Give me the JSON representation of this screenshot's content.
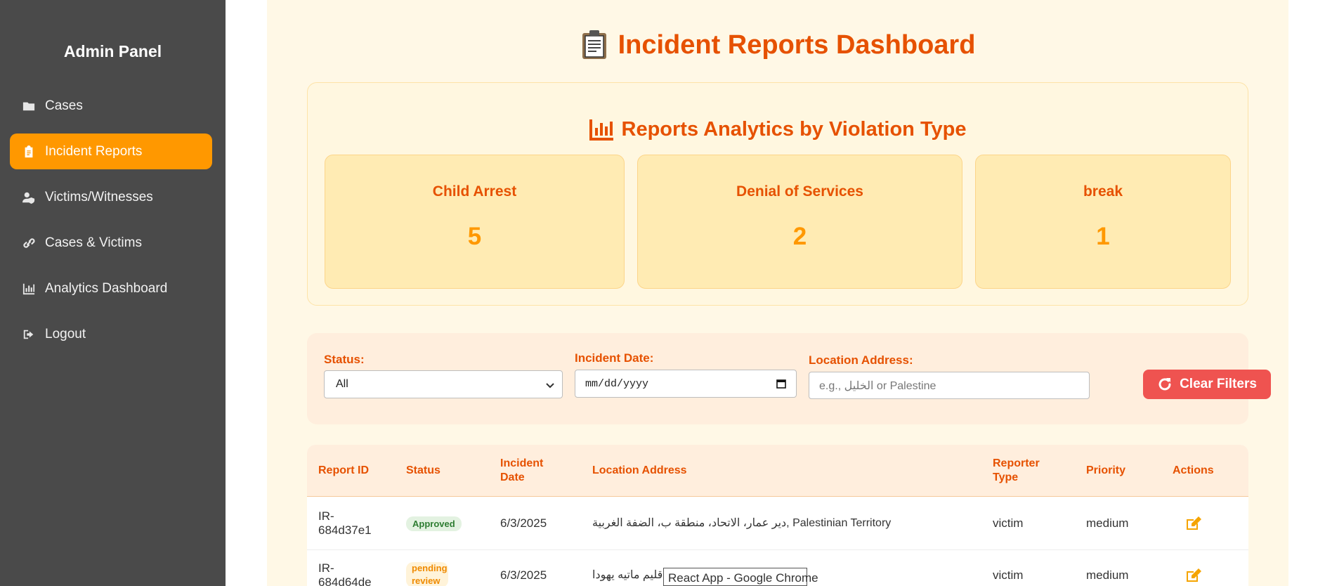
{
  "sidebar": {
    "title": "Admin Panel",
    "items": [
      {
        "label": "Cases",
        "icon": "folder-icon",
        "active": false
      },
      {
        "label": "Incident Reports",
        "icon": "clipboard-icon",
        "active": true
      },
      {
        "label": "Victims/Witnesses",
        "icon": "user-shield-icon",
        "active": false
      },
      {
        "label": "Cases & Victims",
        "icon": "link-icon",
        "active": false
      },
      {
        "label": "Analytics Dashboard",
        "icon": "chart-bar-icon",
        "active": false
      },
      {
        "label": "Logout",
        "icon": "sign-out-icon",
        "active": false
      }
    ]
  },
  "page": {
    "title": "Incident Reports Dashboard",
    "title_icon": "clipboard-emoji-icon"
  },
  "analytics": {
    "title": "Reports Analytics by Violation Type",
    "title_icon": "chart-bar-icon",
    "cards": [
      {
        "label": "Child Arrest",
        "value": "5"
      },
      {
        "label": "Denial of Services",
        "value": "2"
      },
      {
        "label": "break",
        "value": "1"
      }
    ]
  },
  "filters": {
    "status_label": "Status:",
    "status_value": "All",
    "date_label": "Incident Date:",
    "date_value": "mm/dd/yyyy",
    "location_label": "Location Address:",
    "location_placeholder": "e.g., الخليل or Palestine",
    "clear_button": "Clear Filters"
  },
  "table": {
    "columns": [
      "Report ID",
      "Status",
      "Incident Date",
      "Location Address",
      "Reporter Type",
      "Priority",
      "Actions"
    ],
    "rows": [
      {
        "id": "IR-684d37e1",
        "status": "Approved",
        "date": "6/3/2025",
        "location": "دير عمار، الاتحاد، منطقة ب، الضفة الغربية, Palestinian Territory",
        "reporter": "victim",
        "priority": "medium"
      },
      {
        "id": "IR-684d64de",
        "status": "pending review",
        "date": "6/3/2025",
        "location": "قضاء أورشليم القدس، إقليم ماتيه يهودا",
        "reporter": "victim",
        "priority": "medium"
      }
    ]
  },
  "tooltip": {
    "text": "React App - Google Chrome"
  },
  "colors": {
    "sidebar_bg": "#4a4a4a",
    "accent": "#ff9800",
    "title": "#e65100",
    "danger": "#ef5350",
    "approved": "#2e7d32"
  }
}
